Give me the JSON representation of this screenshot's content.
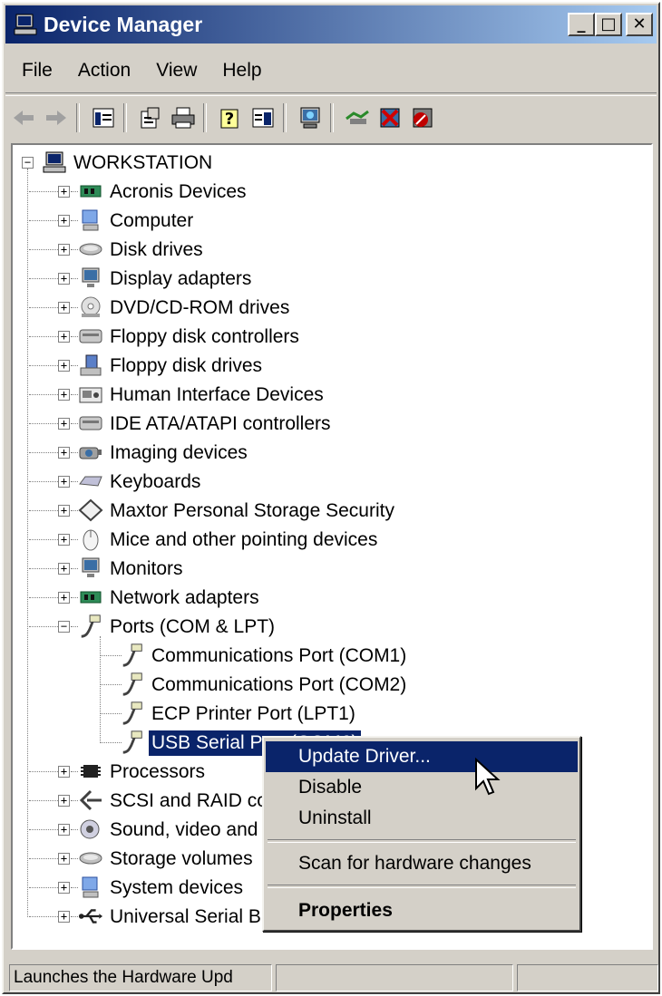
{
  "window": {
    "title": "Device Manager",
    "controls": {
      "minimize": "_",
      "maximize": "□",
      "close": "✕"
    }
  },
  "menu": [
    "File",
    "Action",
    "View",
    "Help"
  ],
  "toolbar": {
    "icons": [
      "back-arrow-icon",
      "forward-arrow-icon",
      "show-hide-console-tree-icon",
      "properties-icon",
      "print-icon",
      "help-icon",
      "show-hide-action-pane-icon",
      "scan-hardware-icon",
      "update-driver-icon",
      "uninstall-icon",
      "disable-icon"
    ]
  },
  "tree": {
    "root": "WORKSTATION",
    "items": [
      {
        "label": "Acronis Devices",
        "icon": "chip-board-icon"
      },
      {
        "label": "Computer",
        "icon": "computer-icon"
      },
      {
        "label": "Disk drives",
        "icon": "disk-drive-icon"
      },
      {
        "label": "Display adapters",
        "icon": "monitor-icon"
      },
      {
        "label": "DVD/CD-ROM drives",
        "icon": "cd-drive-icon"
      },
      {
        "label": "Floppy disk controllers",
        "icon": "controller-icon"
      },
      {
        "label": "Floppy disk drives",
        "icon": "floppy-drive-icon"
      },
      {
        "label": "Human Interface Devices",
        "icon": "hid-icon"
      },
      {
        "label": "IDE ATA/ATAPI controllers",
        "icon": "controller-icon"
      },
      {
        "label": "Imaging devices",
        "icon": "camera-icon"
      },
      {
        "label": "Keyboards",
        "icon": "keyboard-icon"
      },
      {
        "label": "Maxtor Personal Storage Security",
        "icon": "diamond-icon"
      },
      {
        "label": "Mice and other pointing devices",
        "icon": "mouse-icon"
      },
      {
        "label": "Monitors",
        "icon": "monitor-icon"
      },
      {
        "label": "Network adapters",
        "icon": "chip-board-icon"
      },
      {
        "label": "Ports (COM & LPT)",
        "icon": "port-icon",
        "expanded": true
      },
      {
        "label": "Communications Port (COM1)",
        "icon": "port-icon",
        "child": true
      },
      {
        "label": "Communications Port (COM2)",
        "icon": "port-icon",
        "child": true
      },
      {
        "label": "ECP Printer Port (LPT1)",
        "icon": "port-icon",
        "child": true
      },
      {
        "label": "USB Serial Port (COM6)",
        "icon": "port-icon",
        "child": true,
        "selected": true
      },
      {
        "label": "Processors",
        "icon": "processor-icon"
      },
      {
        "label": "SCSI and RAID controllers",
        "icon": "scsi-icon"
      },
      {
        "label": "Sound, video and game controllers",
        "icon": "sound-icon"
      },
      {
        "label": "Storage volumes",
        "icon": "disk-drive-icon"
      },
      {
        "label": "System devices",
        "icon": "computer-icon"
      },
      {
        "label": "Universal Serial Bus controllers",
        "icon": "usb-icon"
      }
    ]
  },
  "context_menu": {
    "items": [
      "Update Driver...",
      "Disable",
      "Uninstall",
      "Scan for hardware changes",
      "Properties"
    ],
    "highlighted": "Update Driver..."
  },
  "statusbar": {
    "text": "Launches the Hardware Upd"
  },
  "colors": {
    "selection": "#0a246a",
    "face": "#d4d0c8"
  }
}
